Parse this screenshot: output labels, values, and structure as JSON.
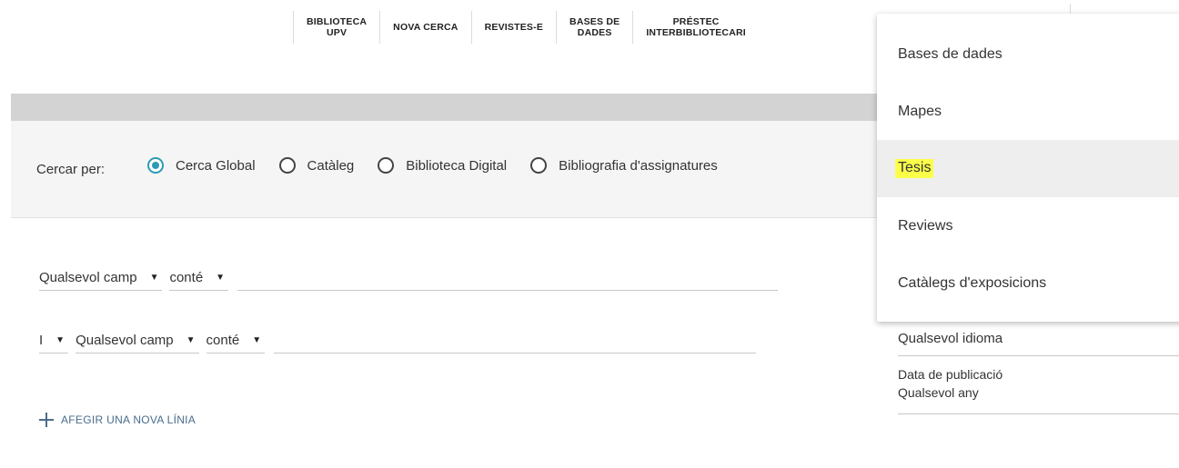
{
  "topnav": {
    "items": [
      {
        "label": "BIBLIOTECA\nUPV"
      },
      {
        "label": "NOVA CERCA"
      },
      {
        "label": "REVISTES-E"
      },
      {
        "label": "BASES DE\nDADES"
      },
      {
        "label": "PRÉSTEC\nINTERBIBLIOTECARI"
      }
    ]
  },
  "search_by": {
    "label": "Cercar per:",
    "options": [
      {
        "label": "Cerca Global",
        "checked": true
      },
      {
        "label": "Catàleg",
        "checked": false
      },
      {
        "label": "Biblioteca Digital",
        "checked": false
      },
      {
        "label": "Bibliografia d'assignatures",
        "checked": false
      }
    ]
  },
  "query_rows": [
    {
      "field": "Qualsevol camp",
      "operator": "conté",
      "value": ""
    },
    {
      "boolean": "I",
      "field": "Qualsevol camp",
      "operator": "conté",
      "value": ""
    }
  ],
  "add_line": {
    "label": "AFEGIR UNA NOVA LÍNIA"
  },
  "filters": {
    "language": "Qualsevol idioma",
    "date_title": "Data de publicació",
    "date_value": "Qualsevol any"
  },
  "dropdown": {
    "items": [
      {
        "label": "Bases de dades"
      },
      {
        "label": "Mapes"
      },
      {
        "label": "Tesis",
        "highlighted": true
      },
      {
        "label": "Reviews"
      },
      {
        "label": "Catàlegs d'exposicions"
      }
    ]
  },
  "colors": {
    "accent": "#2d9bb5",
    "link": "#4a6d8c",
    "highlight": "#fbff4a",
    "band": "#f5f5f5",
    "bar": "#d3d3d3"
  },
  "icons": {
    "caret": "triangle-down-icon",
    "add": "plus-icon"
  }
}
